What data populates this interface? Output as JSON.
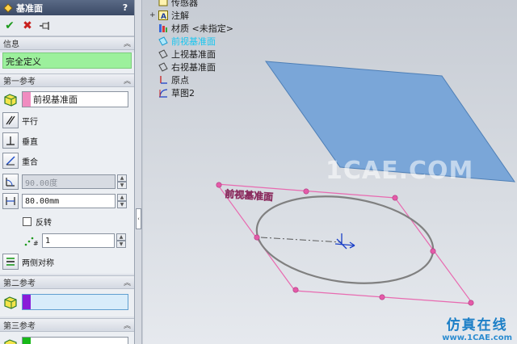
{
  "panel": {
    "title": "基准面",
    "help": "?",
    "toolbar": {
      "ok": "✔",
      "cancel": "✖",
      "pin": "pin"
    },
    "info": {
      "header": "信息",
      "status": "完全定义"
    },
    "first_ref": {
      "header": "第一参考",
      "selection": "前视基准面",
      "selection_color": "#f08cc0",
      "options": [
        {
          "label": "平行"
        },
        {
          "label": "垂直"
        },
        {
          "label": "重合"
        }
      ],
      "angle_value": "90.00度",
      "distance_value": "80.00mm",
      "flip_label": "反转",
      "count_value": "1",
      "midplane_label": "两侧对称"
    },
    "second_ref": {
      "header": "第二参考",
      "swatch_color": "#8a1cd8"
    },
    "third_ref": {
      "header": "第三参考",
      "swatch_color": "#18b818"
    }
  },
  "tree": {
    "items": [
      {
        "label": "传感器",
        "icon": "sensor-icon",
        "expander": ""
      },
      {
        "label": "注解",
        "icon": "annotation-icon",
        "expander": "+"
      },
      {
        "label": "材质 <未指定>",
        "icon": "material-icon",
        "expander": ""
      },
      {
        "label": "前视基准面",
        "icon": "plane-icon",
        "expander": ""
      },
      {
        "label": "上视基准面",
        "icon": "plane-icon",
        "expander": ""
      },
      {
        "label": "右视基准面",
        "icon": "plane-icon",
        "expander": ""
      },
      {
        "label": "原点",
        "icon": "origin-icon",
        "expander": ""
      },
      {
        "label": "草图2",
        "icon": "sketch-icon",
        "expander": ""
      }
    ]
  },
  "viewport": {
    "plane_label": "前视基准面",
    "watermark": "1CAE.COM",
    "brand_cn": "仿真在线",
    "brand_url": "www.1CAE.com",
    "colors": {
      "plane_fill": "#7aa6d8",
      "preview_outline": "#e86ab0",
      "ellipse": "#808080"
    }
  }
}
